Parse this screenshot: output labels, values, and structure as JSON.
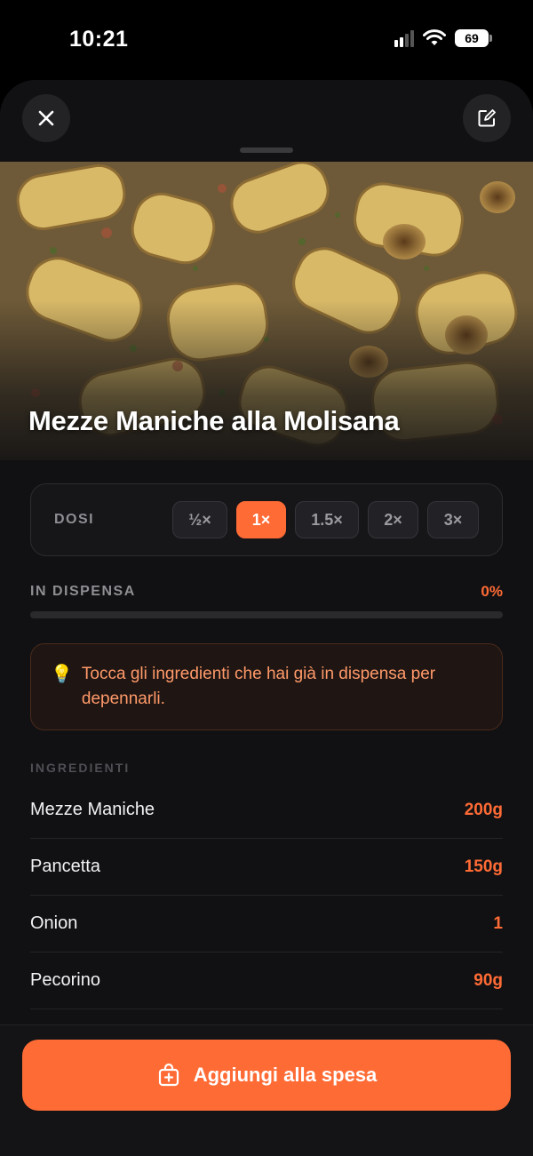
{
  "status_bar": {
    "time": "10:21",
    "battery": "69"
  },
  "header": {
    "close_icon": "close-icon",
    "edit_icon": "edit-icon"
  },
  "recipe": {
    "title": "Mezze Maniche alla Molisana"
  },
  "dosi": {
    "label": "DOSI",
    "options": [
      "½×",
      "1×",
      "1.5×",
      "2×",
      "3×"
    ],
    "selected": "1×"
  },
  "pantry": {
    "label": "IN DISPENSA",
    "percent_text": "0%",
    "progress": 0
  },
  "tip": {
    "icon": "lightbulb-icon",
    "text": "Tocca gli ingredienti che hai già in dispensa per depennarli."
  },
  "ingredients": {
    "label": "INGREDIENTI",
    "items": [
      {
        "name": "Mezze Maniche",
        "qty": "200g"
      },
      {
        "name": "Pancetta",
        "qty": "150g"
      },
      {
        "name": "Onion",
        "qty": "1"
      },
      {
        "name": "Pecorino",
        "qty": "90g"
      }
    ]
  },
  "cta": {
    "label": "Aggiungi alla spesa",
    "icon": "shopping-bag-plus-icon"
  },
  "colors": {
    "accent": "#ff6b35",
    "background": "#111113"
  }
}
